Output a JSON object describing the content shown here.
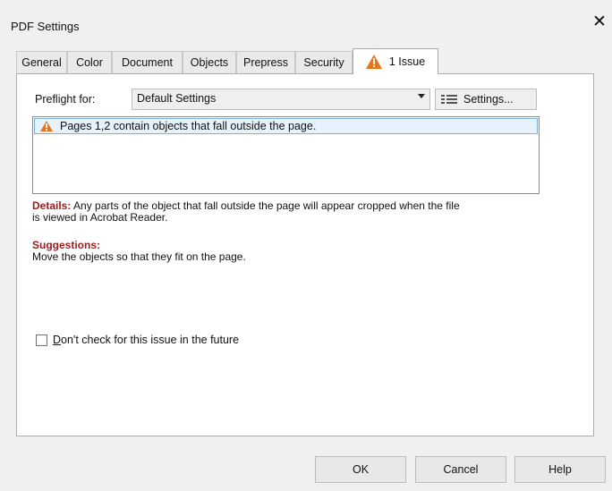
{
  "window": {
    "title": "PDF Settings",
    "close_glyph": "✕"
  },
  "tabs": [
    {
      "label": "General",
      "active": false
    },
    {
      "label": "Color",
      "active": false
    },
    {
      "label": "Document",
      "active": false
    },
    {
      "label": "Objects",
      "active": false
    },
    {
      "label": "Prepress",
      "active": false
    },
    {
      "label": "Security",
      "active": false
    },
    {
      "label": "1 Issue",
      "active": true,
      "icon": "warning-icon"
    }
  ],
  "preflight": {
    "label": "Preflight for:",
    "selected": "Default Settings",
    "settings_button": "Settings..."
  },
  "issues": [
    {
      "text": "Pages 1,2 contain objects that fall outside the page.",
      "icon": "warning-icon",
      "selected": true
    }
  ],
  "details": {
    "label": "Details:",
    "text": " Any parts of the object that fall outside the page will appear cropped when the file",
    "text_line2": "is viewed in Acrobat Reader."
  },
  "suggestions": {
    "label": "Suggestions:",
    "text": "Move the objects so that they fit on the page."
  },
  "checkbox": {
    "label_prefix": "D",
    "label_rest": "on't check for this issue in the future",
    "checked": false
  },
  "buttons": {
    "ok": "OK",
    "cancel": "Cancel",
    "help": "Help"
  },
  "colors": {
    "warning": "#e8751a",
    "details_red": "#9b1c1c",
    "selection": "#e6f2fc"
  }
}
